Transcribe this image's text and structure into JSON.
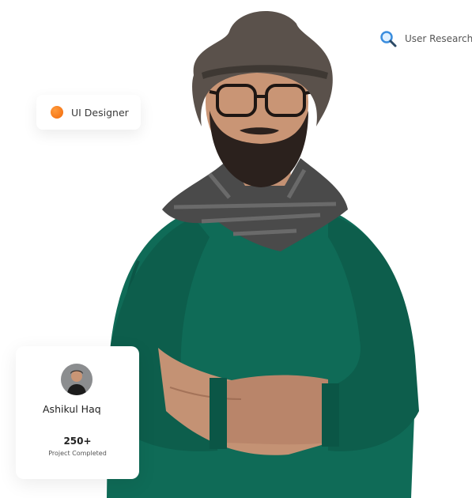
{
  "tags": {
    "designer": {
      "label": "UI Designer",
      "icon": "orange-dot-icon",
      "color": "#f26a0b"
    },
    "research": {
      "label": "User Research",
      "icon": "search-icon",
      "color": "#3a8dde"
    }
  },
  "profile": {
    "name": "Ashikul Haq",
    "count": "250+",
    "count_label": "Project Completed"
  },
  "colors": {
    "sweater": "#0f6b57",
    "hat": "#5a514b",
    "skin": "#c99575"
  }
}
